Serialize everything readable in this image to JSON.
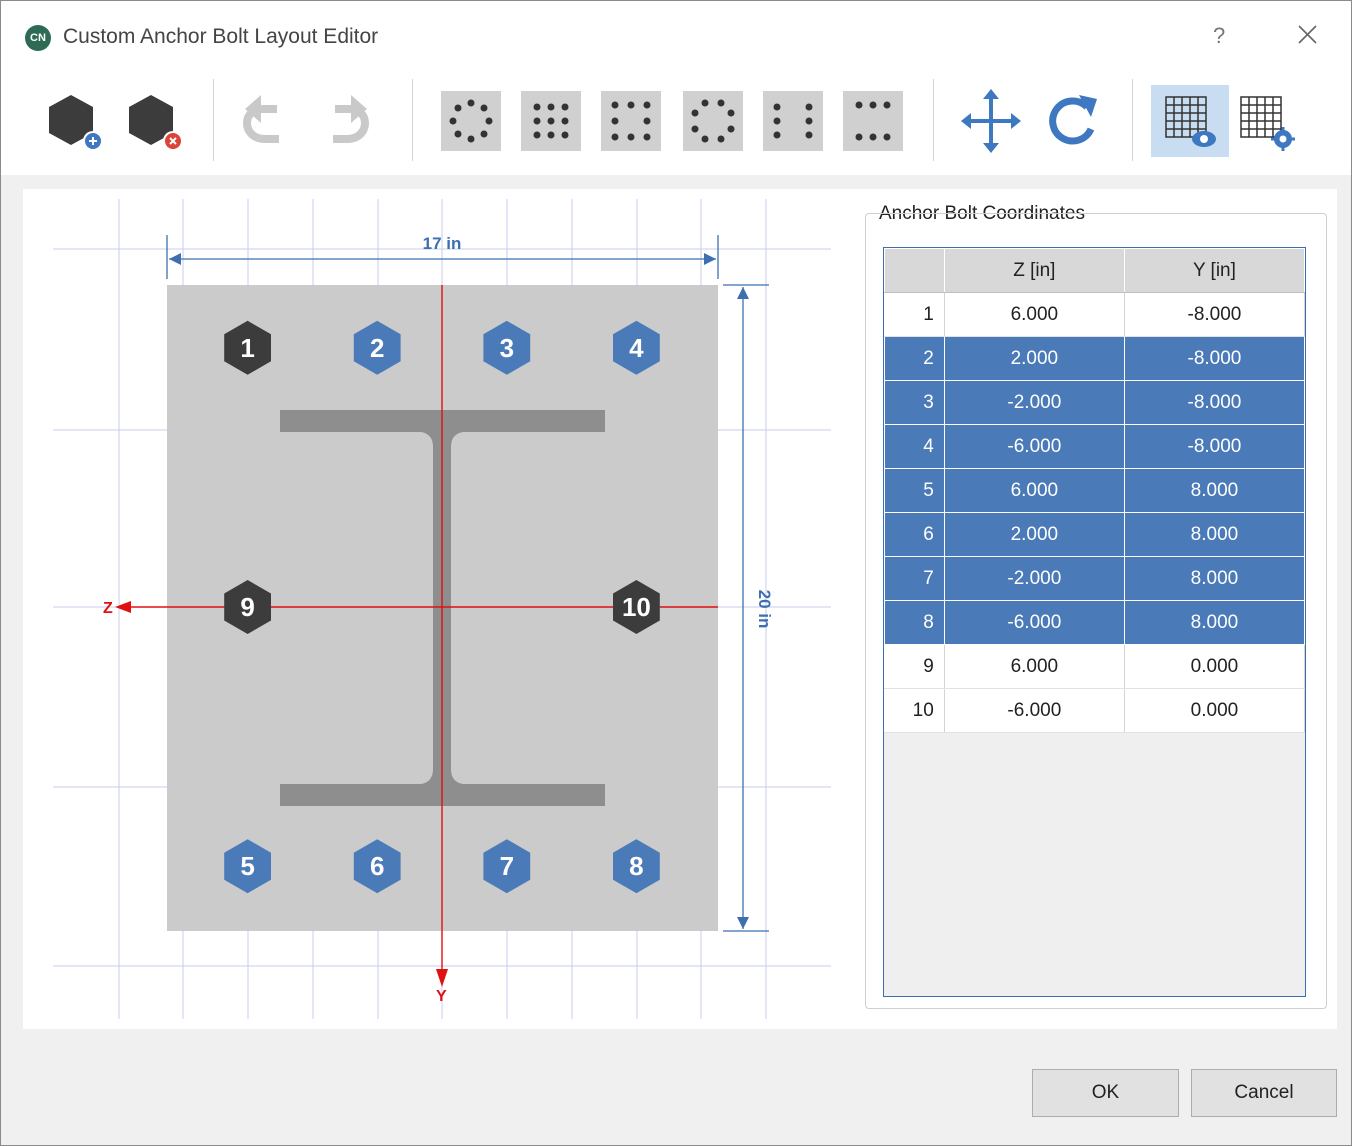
{
  "window": {
    "app_icon_text": "CN",
    "title": "Custom Anchor Bolt Layout Editor",
    "help_label": "?"
  },
  "toolbar": {
    "buttons": [
      {
        "name": "add-bolt-icon"
      },
      {
        "name": "remove-bolt-icon"
      },
      {
        "name": "undo-icon"
      },
      {
        "name": "redo-icon"
      },
      {
        "name": "circular-pattern-icon"
      },
      {
        "name": "grid-3x3-pattern-icon"
      },
      {
        "name": "perimeter-rect-pattern-icon"
      },
      {
        "name": "octagon-pattern-icon"
      },
      {
        "name": "two-column-pattern-icon"
      },
      {
        "name": "two-row-pattern-icon"
      },
      {
        "name": "move-icon"
      },
      {
        "name": "rotate-icon"
      },
      {
        "name": "show-grid-icon",
        "active": true
      },
      {
        "name": "grid-settings-icon"
      }
    ]
  },
  "drawing": {
    "width_label": "17 in",
    "height_label": "20 in",
    "z_axis_label": "Z",
    "y_axis_label": "Y",
    "bolts": [
      {
        "id": "1",
        "style": "dark"
      },
      {
        "id": "2",
        "style": "blue"
      },
      {
        "id": "3",
        "style": "blue"
      },
      {
        "id": "4",
        "style": "blue"
      },
      {
        "id": "5",
        "style": "blue"
      },
      {
        "id": "6",
        "style": "blue"
      },
      {
        "id": "7",
        "style": "blue"
      },
      {
        "id": "8",
        "style": "blue"
      },
      {
        "id": "9",
        "style": "dark"
      },
      {
        "id": "10",
        "style": "dark"
      }
    ]
  },
  "coordinates_panel": {
    "title": "Anchor Bolt Coordinates",
    "headers": [
      "",
      "Z [in]",
      "Y [in]"
    ],
    "rows": [
      {
        "n": "1",
        "z": "6.000",
        "y": "-8.000",
        "selected": false
      },
      {
        "n": "2",
        "z": "2.000",
        "y": "-8.000",
        "selected": true
      },
      {
        "n": "3",
        "z": "-2.000",
        "y": "-8.000",
        "selected": true
      },
      {
        "n": "4",
        "z": "-6.000",
        "y": "-8.000",
        "selected": true
      },
      {
        "n": "5",
        "z": "6.000",
        "y": "8.000",
        "selected": true
      },
      {
        "n": "6",
        "z": "2.000",
        "y": "8.000",
        "selected": true
      },
      {
        "n": "7",
        "z": "-2.000",
        "y": "8.000",
        "selected": true
      },
      {
        "n": "8",
        "z": "-6.000",
        "y": "8.000",
        "selected": true
      },
      {
        "n": "9",
        "z": "6.000",
        "y": "0.000",
        "selected": false
      },
      {
        "n": "10",
        "z": "-6.000",
        "y": "0.000",
        "selected": false
      }
    ]
  },
  "footer": {
    "ok_label": "OK",
    "cancel_label": "Cancel"
  },
  "colors": {
    "accent_blue": "#4a7ab8",
    "bolt_dark": "#3c3c3c",
    "axis_red": "#e01010",
    "plate_gray": "#cbcbcb",
    "beam_gray": "#8e8e8e"
  }
}
